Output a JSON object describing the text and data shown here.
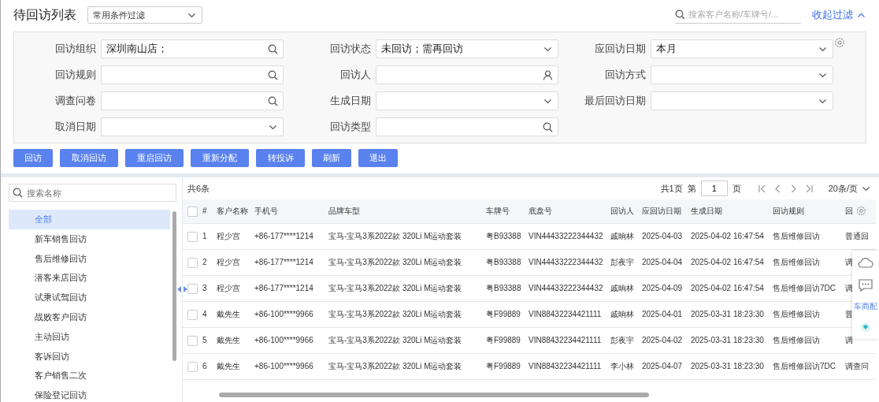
{
  "header": {
    "title": "待回访列表",
    "filter_preset": "常用条件过滤",
    "search_placeholder": "搜索客户名称/车牌号/...",
    "collapse_link": "收起过滤"
  },
  "filters": [
    {
      "label": "回访组织",
      "value": "深圳南山店；",
      "kind": "lookup"
    },
    {
      "label": "回访状态",
      "value": "未回访；需再回访",
      "kind": "select"
    },
    {
      "label": "应回访日期",
      "value": "本月",
      "kind": "select"
    },
    {
      "label": "回访规则",
      "kind": "lookup"
    },
    {
      "label": "回访人",
      "kind": "user"
    },
    {
      "label": "回访方式",
      "kind": "select"
    },
    {
      "label": "调查问卷",
      "kind": "lookup"
    },
    {
      "label": "生成日期",
      "kind": "select"
    },
    {
      "label": "最后回访日期",
      "kind": "select"
    },
    {
      "label": "取消日期",
      "kind": "select"
    },
    {
      "label": "回访类型",
      "kind": "lookup"
    }
  ],
  "buttons": [
    "回访",
    "取消回访",
    "重启回访",
    "重新分配",
    "转投诉",
    "刷新",
    "退出"
  ],
  "sidebar": {
    "search_placeholder": "搜索名称",
    "items": [
      {
        "label": "全部",
        "selected": true
      },
      {
        "label": "新车销售回访",
        "selected": false
      },
      {
        "label": "售后维修回访",
        "selected": false
      },
      {
        "label": "潜客来店回访",
        "selected": false
      },
      {
        "label": "试乘试驾回访",
        "selected": false
      },
      {
        "label": "战败客户回访",
        "selected": false
      },
      {
        "label": "主动回访",
        "selected": false
      },
      {
        "label": "客诉回访",
        "selected": false
      },
      {
        "label": "客户销售二次",
        "selected": false
      },
      {
        "label": "保险登记回访",
        "selected": false
      }
    ]
  },
  "table": {
    "total": "共6条",
    "pager": {
      "pages": "共1页",
      "page_prefix": "第",
      "page": "1",
      "page_suffix": "页",
      "page_size": "20条/页"
    },
    "all_checked": false,
    "columns": [
      "#",
      "客户名称",
      "手机号",
      "品牌车型",
      "车牌号",
      "底盘号",
      "回访人",
      "应回访日期",
      "生成日期",
      "回访规则",
      "回"
    ],
    "rows": [
      {
        "checked": false,
        "cells": [
          "1",
          "程少宫",
          "+86-177****1214",
          "宝马-宝马3系2022款 320Li M运动套装",
          "粤B93388",
          "VIN44433222344432",
          "戚晌林",
          "2025-04-03",
          "2025-04-02 16:47:54",
          "售后维修回访",
          "普通回"
        ]
      },
      {
        "checked": false,
        "cells": [
          "2",
          "程少宫",
          "+86-177****1214",
          "宝马-宝马3系2022款 320Li M运动套装",
          "粤B93388",
          "VIN44433222344432",
          "彭夜宇",
          "2025-04-04",
          "2025-04-02 16:47:54",
          "售后维修回访",
          "调"
        ]
      },
      {
        "checked": false,
        "cells": [
          "3",
          "程少宫",
          "+86-177****1214",
          "宝马-宝马3系2022款 320Li M运动套装",
          "粤B93388",
          "VIN44433222344432",
          "戚晌林",
          "2025-04-09",
          "2025-04-02 16:47:54",
          "售后维修回访7DC",
          "调"
        ]
      },
      {
        "checked": false,
        "cells": [
          "4",
          "戴先生",
          "+86-100****9966",
          "宝马-宝马3系2022款 320Li M运动套装",
          "粤F99889",
          "VIN88432234421111",
          "戚晌林",
          "2025-04-01",
          "2025-03-31 18:23:30",
          "售后维修回访",
          "普"
        ]
      },
      {
        "checked": false,
        "cells": [
          "5",
          "戴先生",
          "+86-100****9966",
          "宝马-宝马3系2022款 320Li M运动套装",
          "粤F99889",
          "VIN88432234421111",
          "彭夜宇",
          "2025-04-02",
          "2025-03-31 18:23:30",
          "售后维修回访",
          "调"
        ]
      },
      {
        "checked": false,
        "cells": [
          "6",
          "戴先生",
          "+86-100****9966",
          "宝马-宝马3系2022款 320Li M运动套装",
          "粤F99889",
          "VIN88432234421111",
          "李小林",
          "2025-04-07",
          "2025-03-31 18:23:30",
          "售后维修回访7DC",
          "调查问"
        ]
      }
    ]
  },
  "float_toolbar": {
    "label": "车商配"
  }
}
